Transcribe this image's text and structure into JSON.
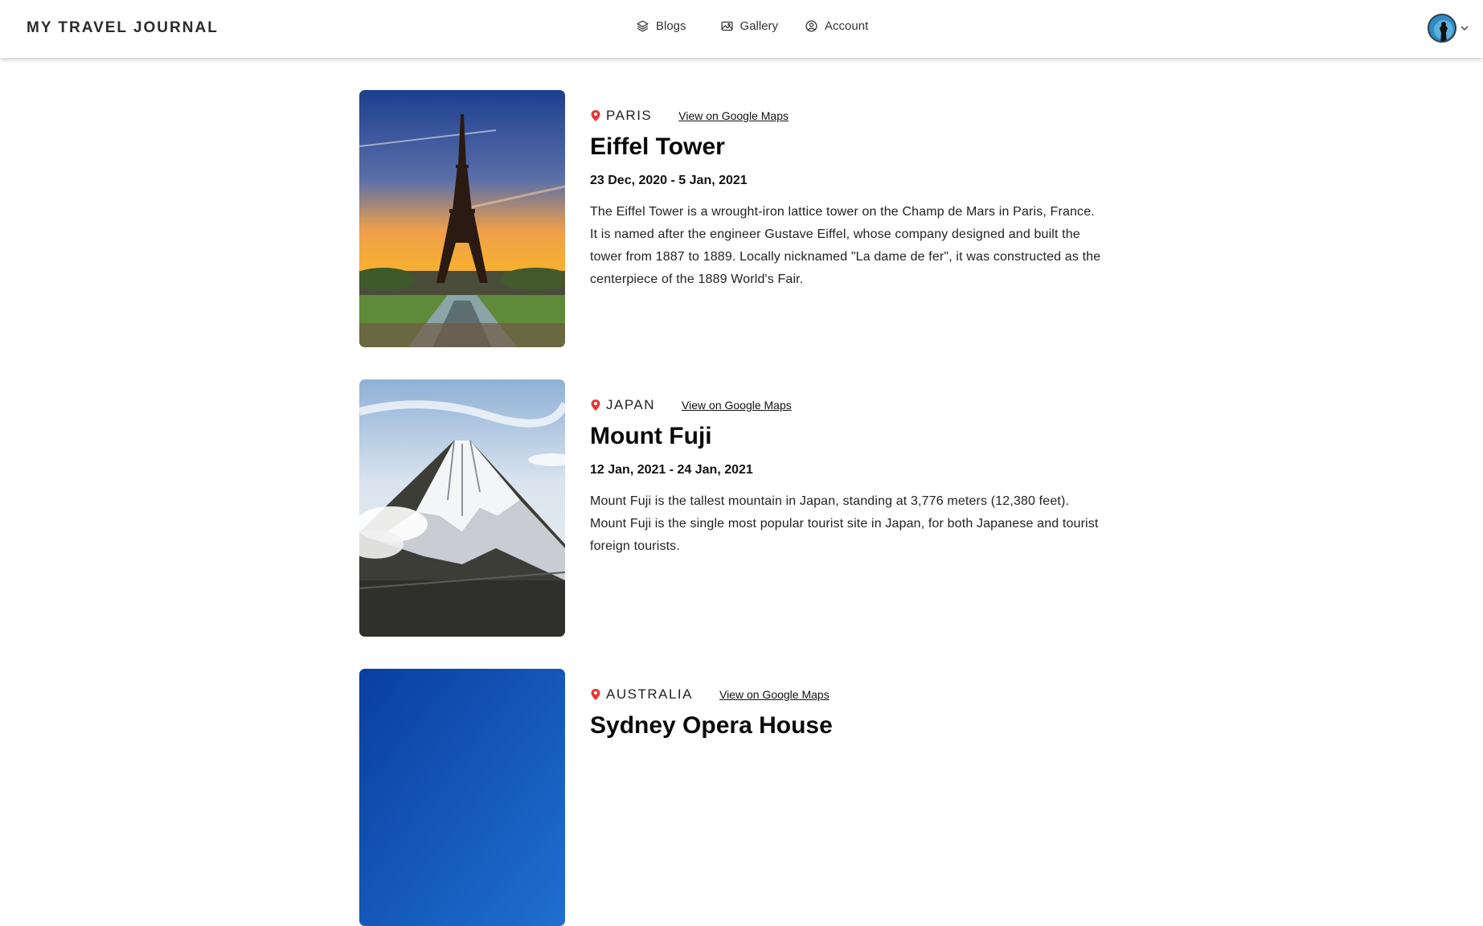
{
  "header": {
    "brand": "MY TRAVEL JOURNAL",
    "nav": [
      {
        "label": "Blogs",
        "icon": "layers-icon"
      },
      {
        "label": "Gallery",
        "icon": "image-icon"
      },
      {
        "label": "Account",
        "icon": "user-circle-icon"
      }
    ]
  },
  "entries": [
    {
      "location": "PARIS",
      "maps_link": "View on Google Maps",
      "title": "Eiffel Tower",
      "dates": "23 Dec, 2020 - 5 Jan, 2021",
      "description": "The Eiffel Tower is a wrought-iron lattice tower on the Champ de Mars in Paris, France. It is named after the engineer Gustave Eiffel, whose company designed and built the tower from 1887 to 1889. Locally nicknamed \"La dame de fer\", it was constructed as the centerpiece of the 1889 World's Fair."
    },
    {
      "location": "JAPAN",
      "maps_link": "View on Google Maps",
      "title": "Mount Fuji",
      "dates": "12 Jan, 2021 - 24 Jan, 2021",
      "description": "Mount Fuji is the tallest mountain in Japan, standing at 3,776 meters (12,380 feet). Mount Fuji is the single most popular tourist site in Japan, for both Japanese and tourist foreign tourists."
    },
    {
      "location": "AUSTRALIA",
      "maps_link": "View on Google Maps",
      "title": "Sydney Opera House",
      "dates": "",
      "description": ""
    }
  ],
  "colors": {
    "pin": "#e53935",
    "text": "#111111",
    "header_shadow": "rgba(0,0,0,0.22)"
  }
}
